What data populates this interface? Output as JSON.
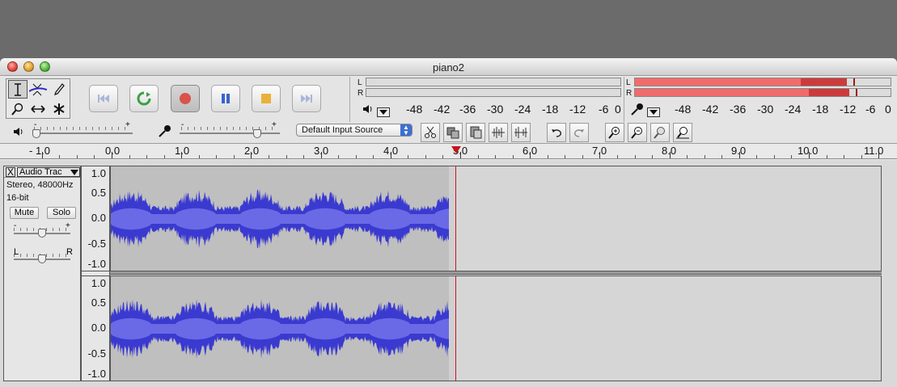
{
  "window": {
    "title": "piano2"
  },
  "tools": [
    {
      "name": "select-tool",
      "glyph": "I"
    },
    {
      "name": "envelope-tool",
      "glyph": "⌄"
    },
    {
      "name": "draw-tool",
      "glyph": "✎"
    },
    {
      "name": "zoom-tool",
      "glyph": "⚲"
    },
    {
      "name": "timeshift-tool",
      "glyph": "↔"
    },
    {
      "name": "multi-tool",
      "glyph": "✱"
    }
  ],
  "transport": {
    "skip_start_icon": "skip-to-start",
    "play_icon": "play",
    "record_icon": "record",
    "pause_icon": "pause",
    "stop_icon": "stop",
    "skip_end_icon": "skip-to-end"
  },
  "playback_meter": {
    "channel_l": "L",
    "channel_r": "R",
    "scale": [
      "-48",
      "-42",
      "-36",
      "-30",
      "-24",
      "-18",
      "-12",
      "-6",
      "0"
    ]
  },
  "record_meter": {
    "channel_l": "L",
    "channel_r": "R",
    "scale": [
      "-48",
      "-42",
      "-36",
      "-30",
      "-24",
      "-18",
      "-12",
      "-6",
      "0"
    ],
    "levels": {
      "left_rms": 0.65,
      "left_peak": 0.83,
      "right_rms": 0.68,
      "right_peak": 0.84
    },
    "color": "#f26b6b"
  },
  "mixer": {
    "output_slider_minus": "-",
    "output_slider_plus": "+",
    "input_slider_minus": "-",
    "input_slider_plus": "+",
    "input_source": "Default Input Source"
  },
  "ruler": {
    "labels": [
      "- 1.0",
      "0.0",
      "1.0",
      "2.0",
      "3.0",
      "4.0",
      "5.0",
      "6.0",
      "7.0",
      "8.0",
      "9.0",
      "10.0",
      "11.0"
    ]
  },
  "track": {
    "name": "Audio Trac",
    "format": "Stereo, 48000Hz",
    "bit_depth": "16-bit",
    "mute_label": "Mute",
    "solo_label": "Solo",
    "gain_minus": "-",
    "gain_plus": "+",
    "pan_left": "L",
    "pan_right": "R",
    "close_glyph": "X",
    "scale_labels": [
      "1.0",
      "0.5",
      "0.0",
      "-0.5",
      "-1.0"
    ],
    "wave_color": "#3a3ad0",
    "wave_rms_color": "#6a6ae6"
  }
}
